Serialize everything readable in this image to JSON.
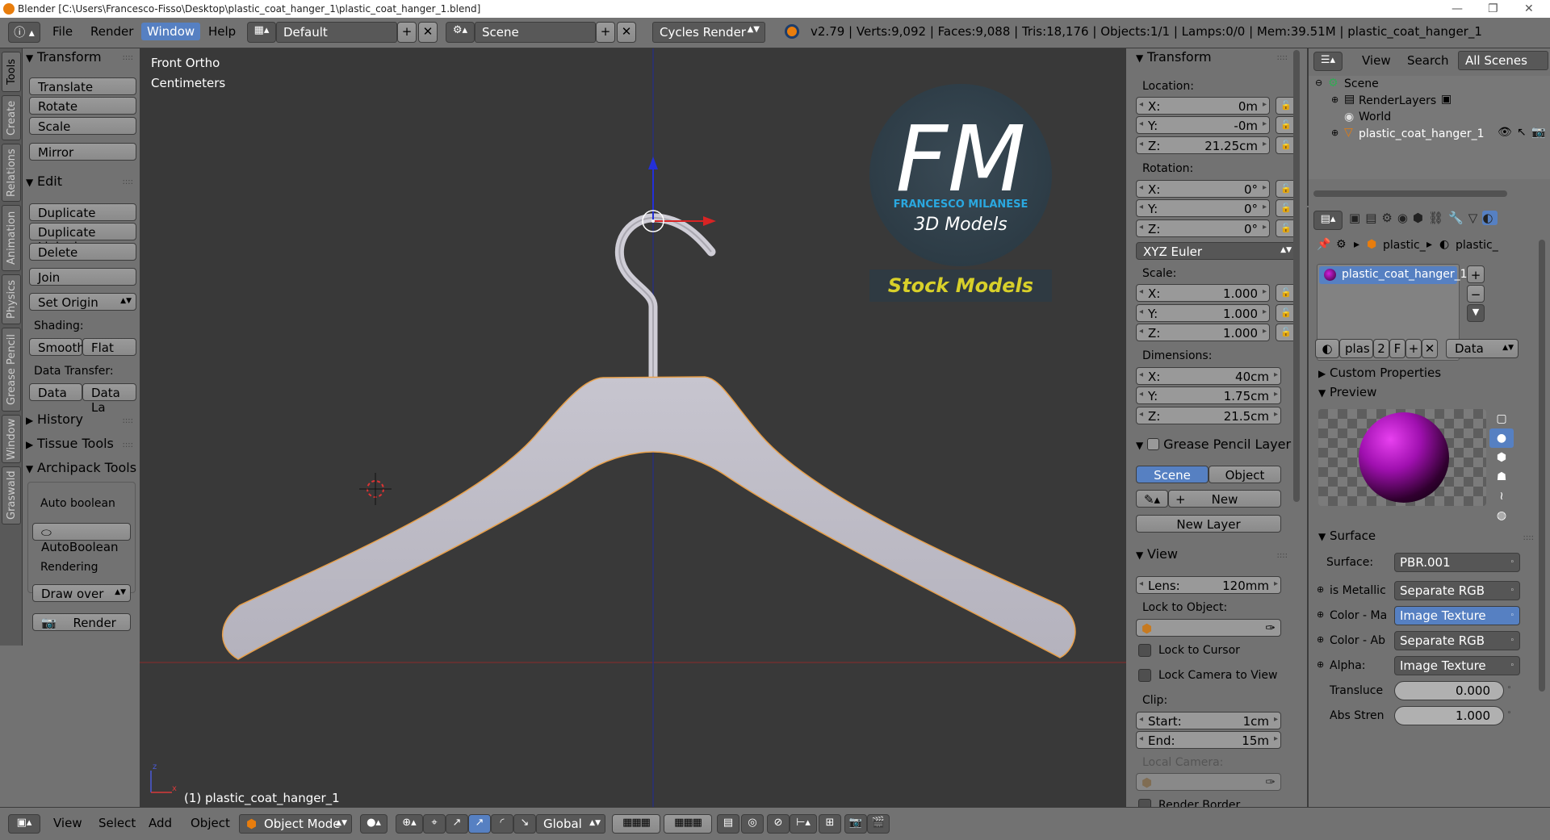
{
  "window": {
    "title": "Blender [C:\\Users\\Francesco-Fisso\\Desktop\\plastic_coat_hanger_1\\plastic_coat_hanger_1.blend]"
  },
  "menu": {
    "file": "File",
    "render": "Render",
    "window": "Window",
    "help": "Help"
  },
  "header": {
    "layout": "Default",
    "scene": "Scene",
    "engine": "Cycles Render",
    "stats": "v2.79 | Verts:9,092 | Faces:9,088 | Tris:18,176 | Objects:1/1 | Lamps:0/0 | Mem:39.51M | plastic_coat_hanger_1"
  },
  "lefttabs": [
    "Tools",
    "Create",
    "Relations",
    "Animation",
    "Physics",
    "Grease Pencil",
    "Window",
    "Graswald"
  ],
  "tools": {
    "transform_title": "Transform",
    "translate": "Translate",
    "rotate": "Rotate",
    "scale": "Scale",
    "mirror": "Mirror",
    "edit_title": "Edit",
    "duplicate": "Duplicate",
    "duplicate_linked": "Duplicate Linked",
    "delete": "Delete",
    "join": "Join",
    "set_origin": "Set Origin",
    "shading": "Shading:",
    "smooth": "Smooth",
    "flat": "Flat",
    "data_transfer": "Data Transfer:",
    "data": "Data",
    "data_la": "Data La",
    "history": "History",
    "tissue": "Tissue Tools",
    "archipack": "Archipack Tools",
    "auto_boolean_label": "Auto boolean",
    "auto_boolean_btn": "AutoBoolean",
    "rendering": "Rendering",
    "draw_over": "Draw over",
    "render": "Render"
  },
  "viewport": {
    "view_name": "Front Ortho",
    "units": "Centimeters",
    "object_label": "(1) plastic_coat_hanger_1",
    "logo_letters": "FM",
    "logo_name": "FRANCESCO MILANESE",
    "logo_sub": "3D Models",
    "stock": "Stock Models"
  },
  "npanel": {
    "transform": "Transform",
    "location": "Location:",
    "loc_x": "0m",
    "loc_y": "-0m",
    "loc_z": "21.25cm",
    "rotation": "Rotation:",
    "rot_x": "0°",
    "rot_y": "0°",
    "rot_z": "0°",
    "rot_mode": "XYZ Euler",
    "scale": "Scale:",
    "sc_x": "1.000",
    "sc_y": "1.000",
    "sc_z": "1.000",
    "dimensions": "Dimensions:",
    "dim_x": "40cm",
    "dim_y": "1.75cm",
    "dim_z": "21.5cm",
    "x": "X:",
    "y": "Y:",
    "z": "Z:",
    "gp_layer": "Grease Pencil Layer",
    "gp_scene": "Scene",
    "gp_object": "Object",
    "gp_new": "New",
    "gp_new_layer": "New Layer",
    "view": "View",
    "lens_label": "Lens:",
    "lens": "120mm",
    "lock_obj": "Lock to Object:",
    "lock_cursor": "Lock to Cursor",
    "lock_camera": "Lock Camera to View",
    "clip": "Clip:",
    "clip_start_label": "Start:",
    "clip_start": "1cm",
    "clip_end_label": "End:",
    "clip_end": "15m",
    "local_camera": "Local Camera:",
    "render_border": "Render Border"
  },
  "outliner": {
    "view": "View",
    "search": "Search",
    "all_scenes": "All Scenes",
    "scene": "Scene",
    "renderlayers": "RenderLayers",
    "world": "World",
    "object": "plastic_coat_hanger_1"
  },
  "props": {
    "crumb1": "plastic_",
    "crumb2": "plastic_",
    "material": "plastic_coat_hanger_1",
    "mat_name": "plas",
    "users": "2",
    "fake": "F",
    "link": "Data",
    "custom": "Custom Properties",
    "preview": "Preview",
    "surface_title": "Surface",
    "surface_label": "Surface:",
    "surface_val": "PBR.001",
    "metallic_label": "is Metallic",
    "metallic_val": "Separate RGB",
    "colorma_label": "Color - Ma",
    "colorma_val": "Image Texture",
    "colorab_label": "Color - Ab",
    "colorab_val": "Separate RGB",
    "alpha_label": "Alpha:",
    "alpha_val": "Image Texture",
    "transl_label": "Transluce",
    "transl_val": "0.000",
    "abs_label": "Abs Stren",
    "abs_val": "1.000"
  },
  "bottom": {
    "view": "View",
    "select": "Select",
    "add": "Add",
    "object": "Object",
    "mode": "Object Mode",
    "orientation": "Global"
  },
  "colors": {
    "accent": "#5680c2",
    "selection": "#e8a04a",
    "logo_blue": "#2aa8e0",
    "stock_yellow": "#d8d02a"
  }
}
